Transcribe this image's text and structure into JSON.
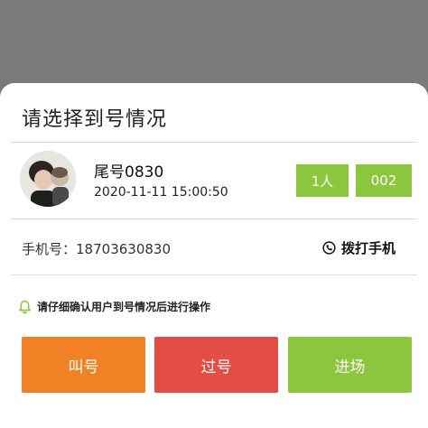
{
  "dialog": {
    "title": "请选择到号情况",
    "customer": {
      "tail_number": "尾号0830",
      "timestamp": "2020-11-11 15:00:50",
      "party_size": "1人",
      "queue_number": "002"
    },
    "phone": {
      "label": "手机号：",
      "number": "18703630830",
      "dial_label": "拨打手机",
      "dial_icon": "phone-dial-icon"
    },
    "notice": {
      "icon": "bell-icon",
      "text": "请仔细确认用户到号情况后进行操作"
    },
    "actions": {
      "call_label": "叫号",
      "skip_label": "过号",
      "enter_label": "进场"
    }
  },
  "colors": {
    "overlay": "#7a7a7a",
    "green": "#8cc63f",
    "orange": "#f08124",
    "red": "#e34d45"
  }
}
